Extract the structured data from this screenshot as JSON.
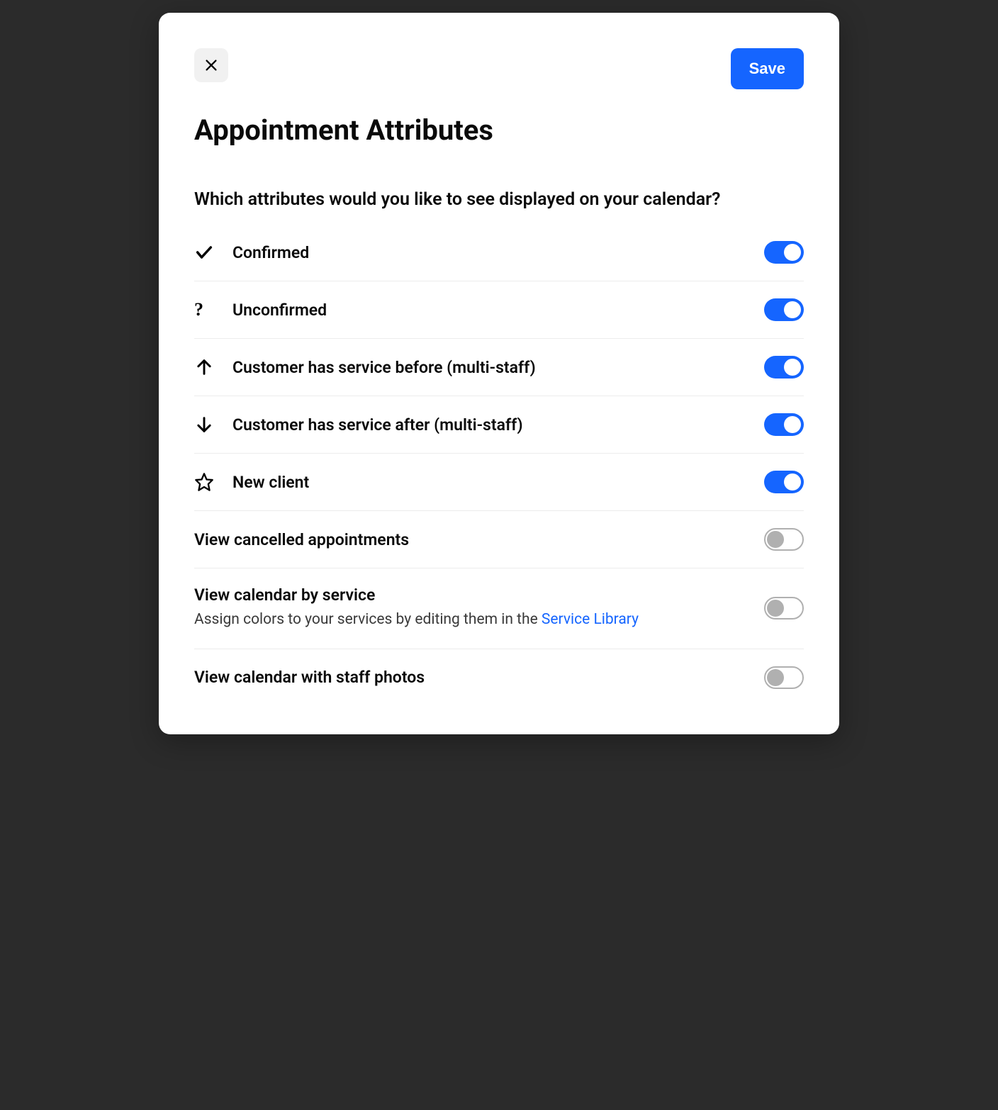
{
  "modal": {
    "title": "Appointment Attributes",
    "subtitle": "Which attributes would you like to see displayed on your calendar?",
    "save_label": "Save"
  },
  "attributes": [
    {
      "icon": "check",
      "label": "Confirmed",
      "enabled": true
    },
    {
      "icon": "question",
      "label": "Unconfirmed",
      "enabled": true
    },
    {
      "icon": "arrow-up",
      "label": "Customer has service before (multi-staff)",
      "enabled": true
    },
    {
      "icon": "arrow-down",
      "label": "Customer has service after (multi-staff)",
      "enabled": true
    },
    {
      "icon": "star",
      "label": "New client",
      "enabled": true
    }
  ],
  "options": {
    "cancelled": {
      "label": "View cancelled appointments",
      "enabled": false
    },
    "by_service": {
      "label": "View calendar by service",
      "desc_prefix": "Assign colors to your services by editing them in the ",
      "link_text": "Service Library",
      "enabled": false
    },
    "staff_photos": {
      "label": "View calendar with staff photos",
      "enabled": false
    }
  }
}
